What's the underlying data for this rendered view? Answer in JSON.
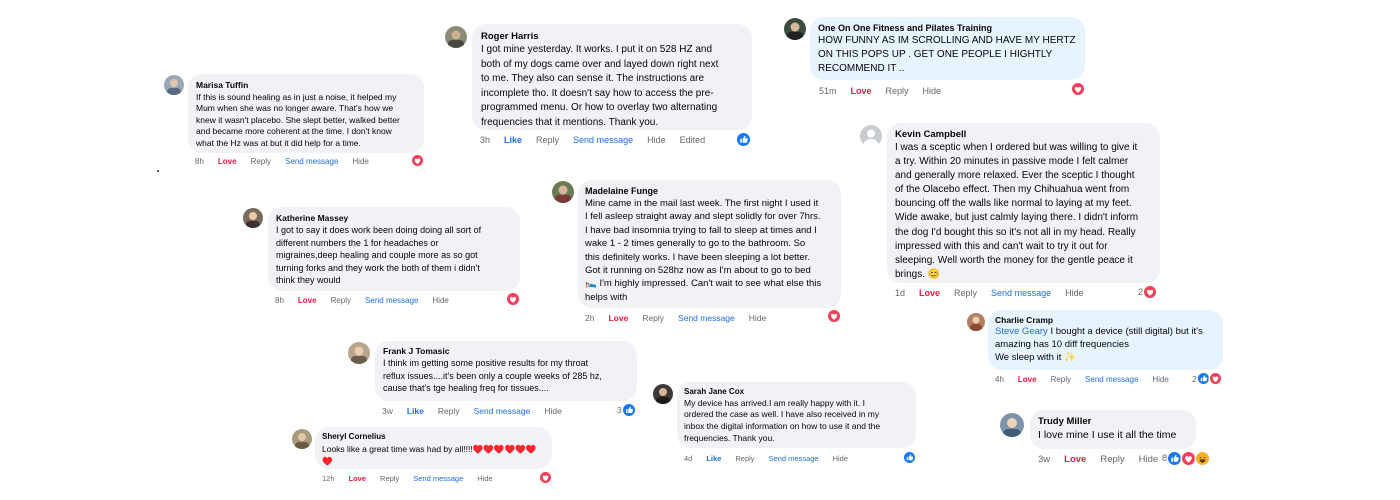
{
  "comments": [
    {
      "name": "Marisa Tuffin",
      "text": "If this is sound healing as in just a noise, it helped my\nMum when she was no longer aware. That's how we\nknew it wasn't placebo. She slept better, walked better\nand became more coherent at the time. I don't know\nwhat the Hz was at but it did help for a time.",
      "actions": [
        "8h",
        "Love",
        "Reply",
        "Send message",
        "Hide"
      ],
      "reactions": {
        "icons": [
          "heart-icon"
        ],
        "count": ""
      }
    },
    {
      "name": "Roger Harris",
      "text": "I got mine yesterday. It works. I put it on 528 HZ and\nboth of my dogs came over and layed down right next\nto me. They also can sense it. The instructions are\nincomplete tho. It doesn't say how to access the pre-\nprogrammed menu. Or how to overlay two alternating\nfrequencies that it mentions. Thank you.",
      "actions": [
        "3h",
        "Like",
        "Reply",
        "Send message",
        "Hide",
        "Edited"
      ],
      "reactions": {
        "icons": [
          "like-icon"
        ],
        "count": ""
      }
    },
    {
      "name": "One On One Fitness and Pilates Training",
      "text": "HOW FUNNY AS IM SCROLLING AND HAVE MY HERTZ\nON THIS POPS UP . GET ONE PEOPLE I HIGHTLY\nRECOMMEND IT ..",
      "actions": [
        "51m",
        "Love",
        "Reply",
        "Hide"
      ],
      "reactions": {
        "icons": [
          "heart-icon"
        ],
        "count": ""
      }
    },
    {
      "name": "Kevin Campbell",
      "text": "I was a sceptic when I ordered but was willing to give it\na try. Within 20 minutes in passive mode I felt calmer\nand generally more relaxed. Ever the sceptic I thought\nof the Olacebo effect. Then my Chihuahua went from\nbouncing off the walls like normal to laying at my feet.\nWide awake, but just calmly laying there. I didn't inform\nthe dog I'd bought this so it's not all in my head. Really\nimpressed with this and can't wait to try it out for\nsleeping. Well worth the money for the gentle peace it\nbrings. 😊",
      "actions": [
        "1d",
        "Love",
        "Reply",
        "Send message",
        "Hide"
      ],
      "reactions": {
        "icons": [
          "heart-icon"
        ],
        "count": "2"
      }
    },
    {
      "name": "Katherine Massey",
      "text": "I got to say it does work been doing doing all sort of\ndifferent numbers the 1 for headaches or\nmigraines,deep healing and couple more as so got\nturning forks and they work the both of them i didn't\nthink they would",
      "actions": [
        "8h",
        "Love",
        "Reply",
        "Send message",
        "Hide"
      ],
      "reactions": {
        "icons": [
          "heart-icon"
        ],
        "count": ""
      }
    },
    {
      "name": "Madelaine Funge",
      "text": "Mine came in the mail last week. The first night I used it\nI fell asleep straight away and slept solidly for over 7hrs.\nI have bad insomnia trying to fall to sleep at times and I\nwake 1 - 2 times generally to go to the bathroom. So\nthis definitely works. I have been sleeping a lot better.\nGot it running on 528hz now as I'm about to go to bed\n🛌 I'm highly impressed. Can't wait to see what else this\nhelps with",
      "actions": [
        "2h",
        "Love",
        "Reply",
        "Send message",
        "Hide"
      ],
      "reactions": {
        "icons": [
          "heart-icon"
        ],
        "count": ""
      }
    },
    {
      "name": "Charlie Cramp",
      "tag": "Steve Geary",
      "text": "I bought a device (still digital) but it's\namazing has 10 diff frequencies\nWe sleep with it ✨",
      "actions": [
        "4h",
        "Love",
        "Reply",
        "Send message",
        "Hide"
      ],
      "reactions": {
        "icons": [
          "like-icon",
          "heart-icon"
        ],
        "count": "2"
      }
    },
    {
      "name": "Frank J Tomasic",
      "text": "I think im getting some positive results for my throat\nreflux issues....it's been only a couple weeks of 285 hz,\ncause that's tge healing freq for tissues....",
      "actions": [
        "3w",
        "Like",
        "Reply",
        "Send message",
        "Hide"
      ],
      "reactions": {
        "icons": [
          "like-icon"
        ],
        "count": "3"
      }
    },
    {
      "name": "Sarah Jane Cox",
      "text": "My device has arrived.I am really happy with it. I\nordered the case as well. I have also received in my\ninbox the digital information on how to use it and the\nfrequencies. Thank you.",
      "actions": [
        "4d",
        "Like",
        "Reply",
        "Send message",
        "Hide"
      ],
      "reactions": {
        "icons": [
          "like-icon"
        ],
        "count": ""
      }
    },
    {
      "name": "Trudy Miller",
      "text": "I love mine I use it all the time",
      "actions": [
        "3w",
        "Love",
        "Reply",
        "Hide"
      ],
      "reactions": {
        "icons": [
          "like-icon",
          "heart-icon",
          "haha-icon"
        ],
        "count": "8"
      }
    },
    {
      "name": "Sheryl Cornelius",
      "text": "Looks like a great time was had by all!!!!♥️♥️♥️♥️♥️♥️\n♥️",
      "actions": [
        "12h",
        "Love",
        "Reply",
        "Send message",
        "Hide"
      ],
      "reactions": {
        "icons": [
          "heart-icon"
        ],
        "count": ""
      }
    }
  ]
}
